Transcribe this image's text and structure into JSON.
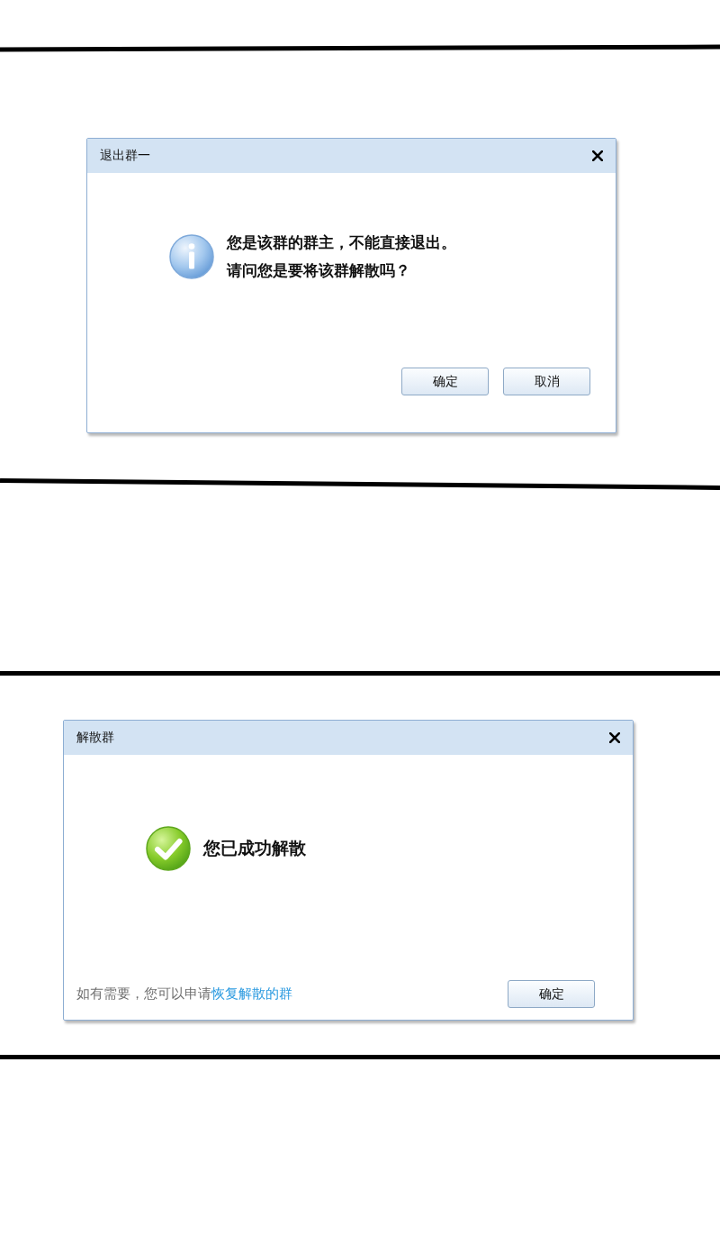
{
  "dialogs": [
    {
      "title": "退出群一",
      "kind": "info",
      "lines": [
        "您是该群的群主，不能直接退出。",
        "请问您是要将该群解散吗？"
      ],
      "buttons": [
        "确定",
        "取消"
      ]
    },
    {
      "title": "解散群",
      "kind": "success",
      "lines": [
        "您已成功解散"
      ],
      "footer_note": {
        "text": "如有需要，您可以申请",
        "link": "恢复解散的群"
      },
      "buttons": [
        "确定"
      ]
    }
  ]
}
